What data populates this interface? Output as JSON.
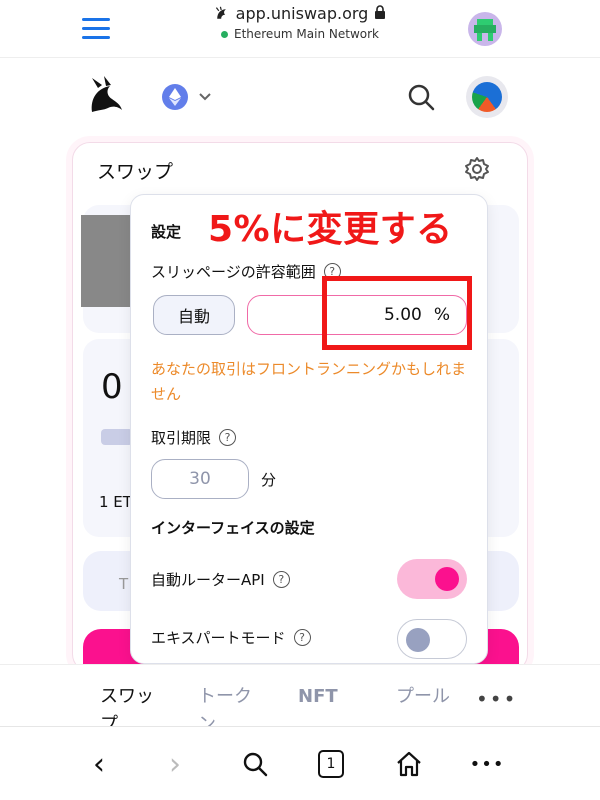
{
  "browser": {
    "url": "app.uniswap.org",
    "network": "Ethereum Main Network"
  },
  "app": {
    "swap_title": "スワップ",
    "amount": "0",
    "rate": "1 ET",
    "connect_label": "T"
  },
  "settings": {
    "title": "設定",
    "slippage_label": "スリッページの許容範囲",
    "auto_label": "自動",
    "slippage_value": "5.00",
    "slippage_unit": "%",
    "warning": "あなたの取引はフロントランニングかもしれません",
    "deadline_label": "取引期限",
    "deadline_value": "30",
    "deadline_unit": "分",
    "interface_title": "インターフェイスの設定",
    "router_label": "自動ルーターAPI",
    "router_on": true,
    "expert_label": "エキスパートモード",
    "expert_on": false,
    "help_glyph": "?"
  },
  "annotation": {
    "text": "5%に変更する",
    "color": "#f01818"
  },
  "nav": {
    "items": [
      {
        "label": "スワップ"
      },
      {
        "label": "トークン"
      },
      {
        "label": "NFT"
      },
      {
        "label": "プール"
      }
    ],
    "more": "•••"
  },
  "browser_toolbar": {
    "back": "‹",
    "forward": "›",
    "tab_count": "1",
    "more": "•••"
  },
  "colors": {
    "accent": "#fb118e",
    "warning": "#ec8a2a",
    "link": "#1a73e8"
  }
}
